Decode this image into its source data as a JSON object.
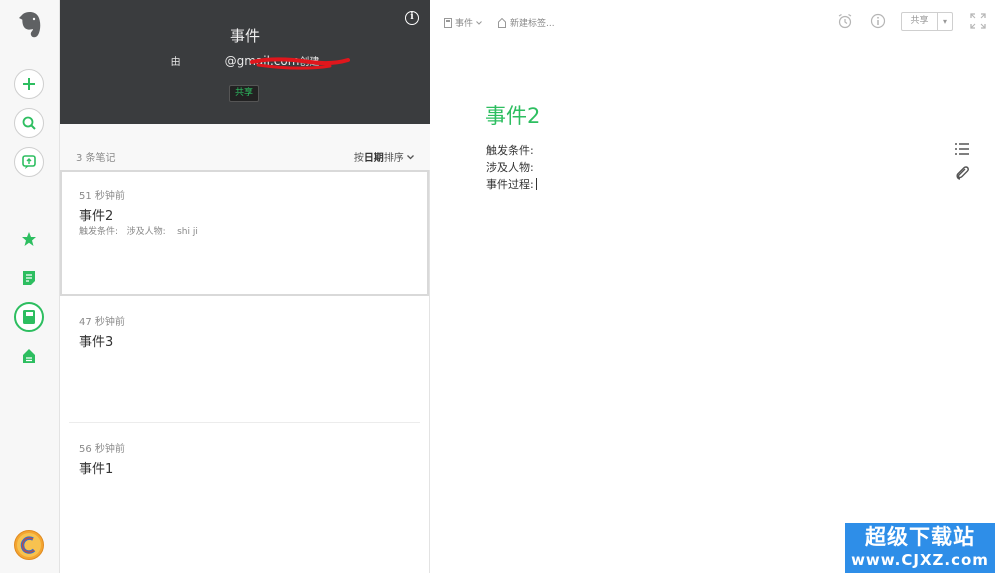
{
  "colors": {
    "accent": "#2dbe60",
    "header_bg": "#3a3c3e",
    "watermark_bg": "#2e8ee8"
  },
  "rail": {
    "items": [
      {
        "name": "new-note-button",
        "icon": "plus-icon"
      },
      {
        "name": "search-button",
        "icon": "search-icon"
      },
      {
        "name": "work-chat-button",
        "icon": "chat-icon"
      },
      {
        "name": "shortcuts-button",
        "icon": "star-icon"
      },
      {
        "name": "notes-button",
        "icon": "note-icon"
      },
      {
        "name": "notebooks-button",
        "icon": "notebook-icon"
      },
      {
        "name": "tags-button",
        "icon": "tag-icon"
      }
    ]
  },
  "notebook": {
    "title": "事件",
    "owner_prefix": "由",
    "owner_email": "@gmail.com",
    "owner_suffix": "创建",
    "share_label": "共享"
  },
  "list": {
    "count_label": "3 条笔记",
    "sort_prefix": "按",
    "sort_key": "日期",
    "sort_suffix": "排序"
  },
  "notes": [
    {
      "time": "51 秒钟前",
      "title": "事件2",
      "snippet": "触发条件:   涉及人物:    shi ji",
      "selected": true
    },
    {
      "time": "47 秒钟前",
      "title": "事件3",
      "snippet": "",
      "selected": false
    },
    {
      "time": "56 秒钟前",
      "title": "事件1",
      "snippet": "",
      "selected": false
    }
  ],
  "editor": {
    "notebook_label": "事件",
    "tag_placeholder": "新建标签...",
    "share_label": "共享",
    "note_title": "事件2",
    "fields": [
      "触发条件:",
      "涉及人物:",
      "事件过程:"
    ]
  },
  "watermark": {
    "line1": "超级下载站",
    "line2": "www.CJXZ.com"
  }
}
